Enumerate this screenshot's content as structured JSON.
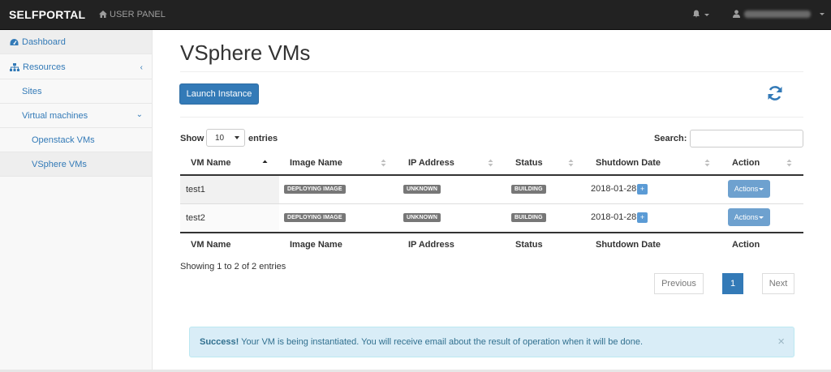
{
  "navbar": {
    "brand": "SELFPORTAL",
    "user_panel": "USER PANEL"
  },
  "sidebar": {
    "items": [
      {
        "label": "Dashboard",
        "icon": "dashboard-icon"
      },
      {
        "label": "Resources",
        "icon": "sitemap-icon"
      },
      {
        "label": "Sites"
      },
      {
        "label": "Virtual machines"
      },
      {
        "label": "Openstack VMs"
      },
      {
        "label": "VSphere VMs"
      }
    ]
  },
  "main": {
    "title": "VSphere VMs",
    "launch_button": "Launch Instance",
    "show_label": "Show",
    "page_length": "10",
    "entries_label": "entries",
    "search_label": "Search:",
    "search_value": ""
  },
  "table": {
    "columns": [
      "VM Name",
      "Image Name",
      "IP Address",
      "Status",
      "Shutdown Date",
      "Action"
    ],
    "rows": [
      {
        "vm_name": "test1",
        "image_name": "DEPLOYING IMAGE",
        "ip_address": "UNKNOWN",
        "status": "BUILDING",
        "shutdown_date": "2018-01-28",
        "extend": "+",
        "action": "Actions"
      },
      {
        "vm_name": "test2",
        "image_name": "DEPLOYING IMAGE",
        "ip_address": "UNKNOWN",
        "status": "BUILDING",
        "shutdown_date": "2018-01-28",
        "extend": "+",
        "action": "Actions"
      }
    ],
    "info": "Showing 1 to 2 of 2 entries"
  },
  "pagination": {
    "previous": "Previous",
    "current": "1",
    "next": "Next"
  },
  "alert": {
    "strong": "Success!",
    "message": " Your VM is being instantiated. You will receive email about the result of operation when it will be done.",
    "close": "×"
  },
  "colors": {
    "navbar_bg": "#222222",
    "primary": "#337ab7",
    "alert_bg": "#d9edf7",
    "label_bg": "#777777"
  }
}
